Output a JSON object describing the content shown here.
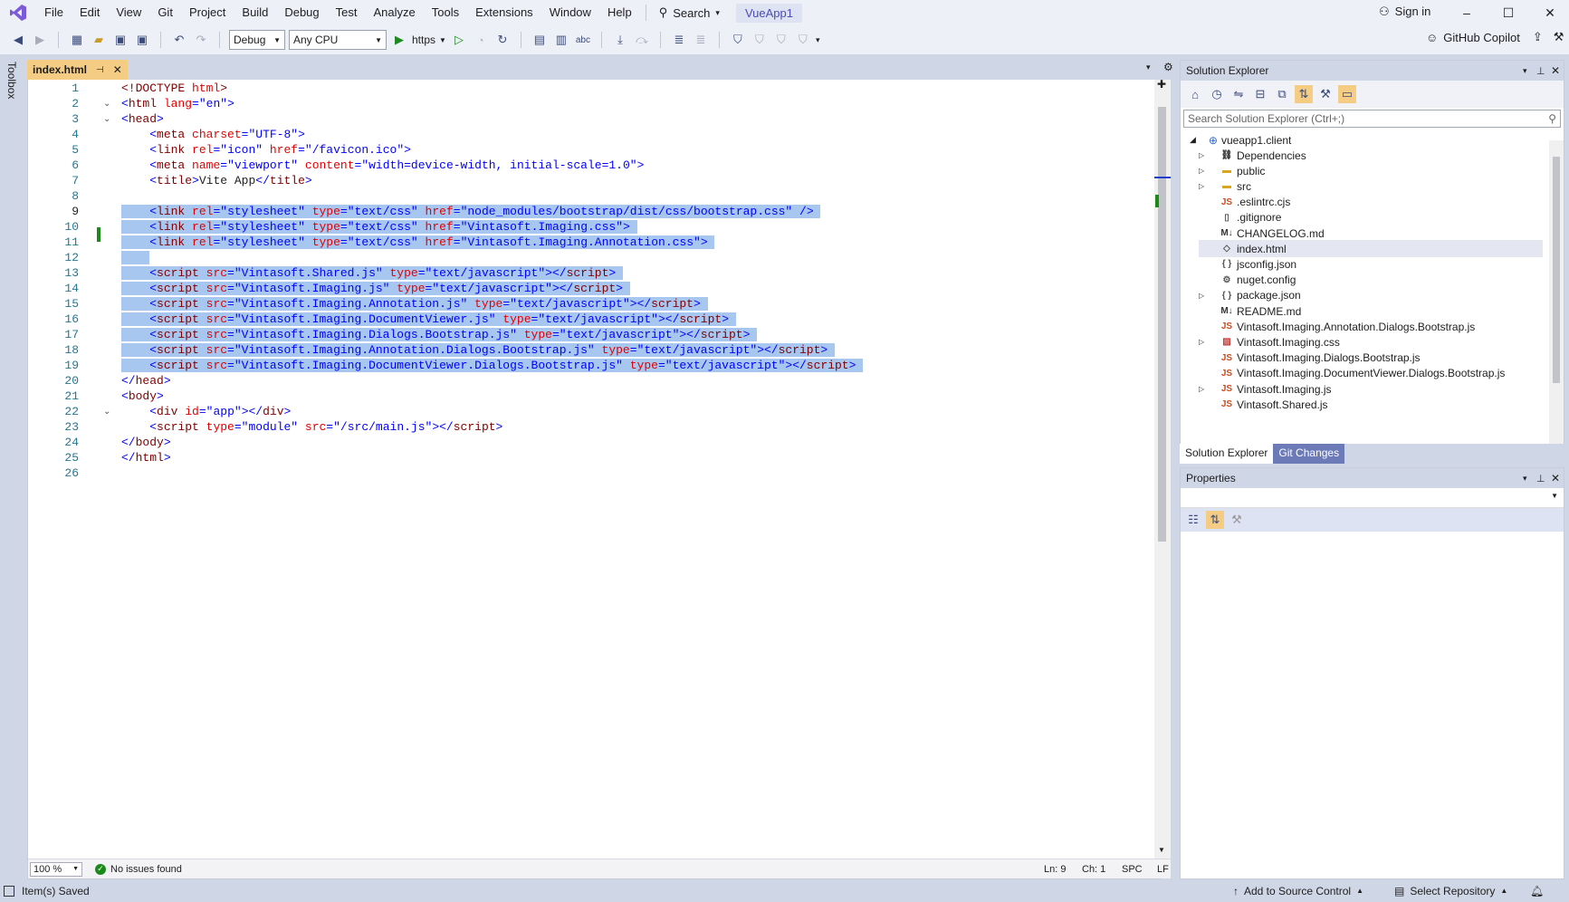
{
  "menu": {
    "items": [
      "File",
      "Edit",
      "View",
      "Git",
      "Project",
      "Build",
      "Debug",
      "Test",
      "Analyze",
      "Tools",
      "Extensions",
      "Window",
      "Help"
    ],
    "search_label": "Search",
    "app_title": "VueApp1",
    "sign_in": "Sign in"
  },
  "toolbar": {
    "config": "Debug",
    "platform": "Any CPU",
    "run_target": "https",
    "copilot": "GitHub Copilot"
  },
  "toolbox": {
    "label": "Toolbox"
  },
  "editor": {
    "tab_title": "index.html",
    "line_numbers": [
      "1",
      "2",
      "3",
      "4",
      "5",
      "6",
      "7",
      "8",
      "9",
      "10",
      "11",
      "12",
      "13",
      "14",
      "15",
      "16",
      "17",
      "18",
      "19",
      "20",
      "21",
      "22",
      "23",
      "24",
      "25",
      "26"
    ],
    "status": {
      "zoom": "100 %",
      "issues": "No issues found",
      "line": "Ln: 9",
      "col": "Ch: 1",
      "ws": "SPC",
      "eol": "LF"
    }
  },
  "solution_explorer": {
    "title": "Solution Explorer",
    "search_placeholder": "Search Solution Explorer (Ctrl+;)",
    "root": "vueapp1.client",
    "items": [
      {
        "label": "Dependencies",
        "icon": "dependencies-icon",
        "expandable": true
      },
      {
        "label": "public",
        "icon": "folder-icon",
        "expandable": true
      },
      {
        "label": "src",
        "icon": "folder-icon",
        "expandable": true
      },
      {
        "label": ".eslintrc.cjs",
        "icon": "js-file-icon",
        "expandable": false
      },
      {
        "label": ".gitignore",
        "icon": "file-icon",
        "expandable": false
      },
      {
        "label": "CHANGELOG.md",
        "icon": "markdown-icon",
        "expandable": false
      },
      {
        "label": "index.html",
        "icon": "html-file-icon",
        "expandable": false,
        "selected": true
      },
      {
        "label": "jsconfig.json",
        "icon": "json-file-icon",
        "expandable": false
      },
      {
        "label": "nuget.config",
        "icon": "config-file-icon",
        "expandable": false
      },
      {
        "label": "package.json",
        "icon": "json-file-icon",
        "expandable": true
      },
      {
        "label": "README.md",
        "icon": "markdown-icon",
        "expandable": false
      },
      {
        "label": "Vintasoft.Imaging.Annotation.Dialogs.Bootstrap.js",
        "icon": "js-file-icon",
        "expandable": false
      },
      {
        "label": "Vintasoft.Imaging.css",
        "icon": "css-file-icon",
        "expandable": true
      },
      {
        "label": "Vintasoft.Imaging.Dialogs.Bootstrap.js",
        "icon": "js-file-icon",
        "expandable": false
      },
      {
        "label": "Vintasoft.Imaging.DocumentViewer.Dialogs.Bootstrap.js",
        "icon": "js-file-icon",
        "expandable": false
      },
      {
        "label": "Vintasoft.Imaging.js",
        "icon": "js-file-icon",
        "expandable": true
      },
      {
        "label": "Vintasoft.Shared.js",
        "icon": "js-file-icon",
        "expandable": false
      }
    ],
    "tabs": [
      "Solution Explorer",
      "Git Changes"
    ]
  },
  "properties": {
    "title": "Properties"
  },
  "statusbar": {
    "message": "Item(s) Saved",
    "source_control": "Add to Source Control",
    "repo": "Select Repository"
  }
}
